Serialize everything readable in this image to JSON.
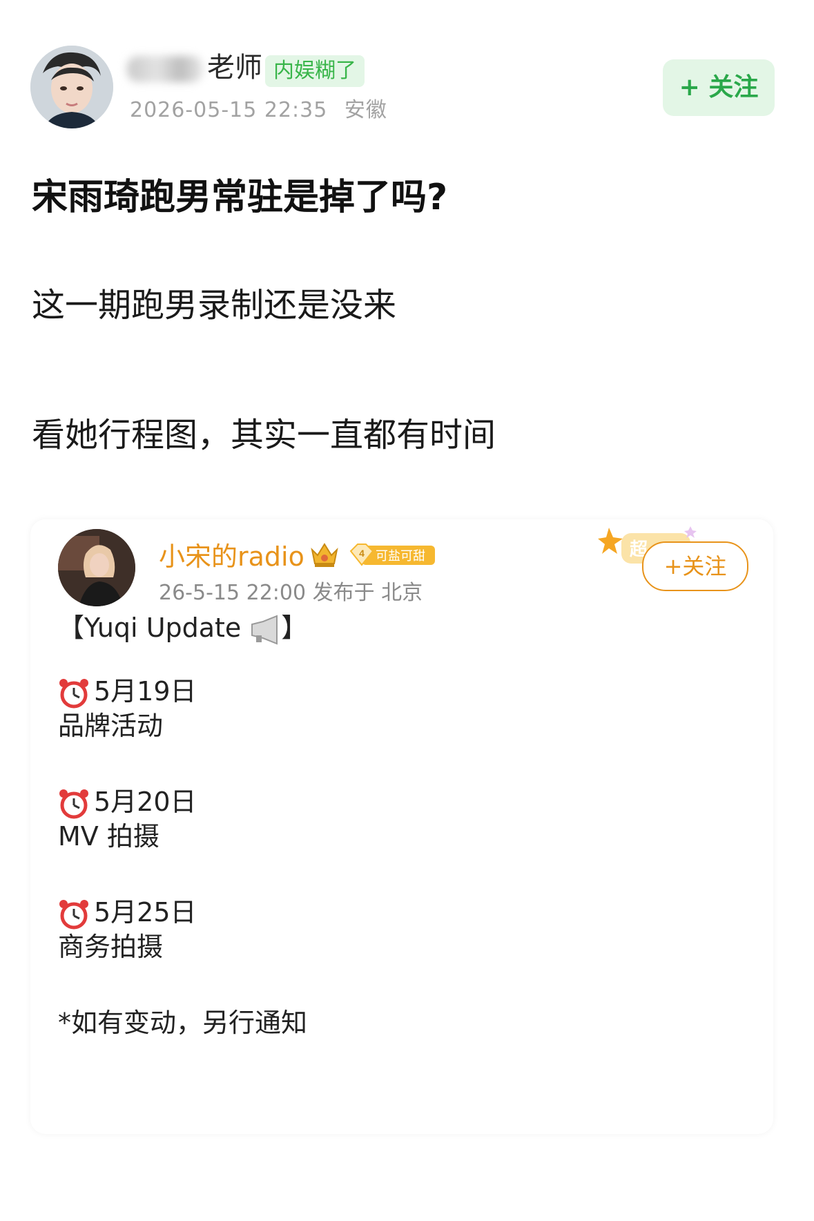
{
  "post": {
    "author_name_visible": "老师",
    "author_tag": "内娱糊了",
    "timestamp": "2026-05-15 22:35",
    "location": "安徽",
    "follow_label": "+ 关注",
    "title": "宋雨琦跑男常驻是掉了吗?",
    "paragraphs": [
      "这一期跑男录制还是没来",
      "看她行程图，其实一直都有时间"
    ]
  },
  "quote": {
    "author_name": "小宋的radio",
    "crown_icon": "crown-icon",
    "level": "4",
    "level_label": "可盐可甜",
    "super_badge": "超",
    "meta": "26-5-15 22:00  发布于 北京",
    "follow_label": "+关注",
    "heading": "【Yuqi Update",
    "heading_end": "】",
    "schedule": [
      {
        "date": "5月19日",
        "event": "品牌活动"
      },
      {
        "date": "5月20日",
        "event": "MV 拍摄"
      },
      {
        "date": "5月25日",
        "event": "商务拍摄"
      }
    ],
    "note": "*如有变动，另行通知"
  },
  "colors": {
    "green_accent": "#39b54a",
    "green_bg": "#e3f6e6",
    "orange_accent": "#e8931a"
  }
}
